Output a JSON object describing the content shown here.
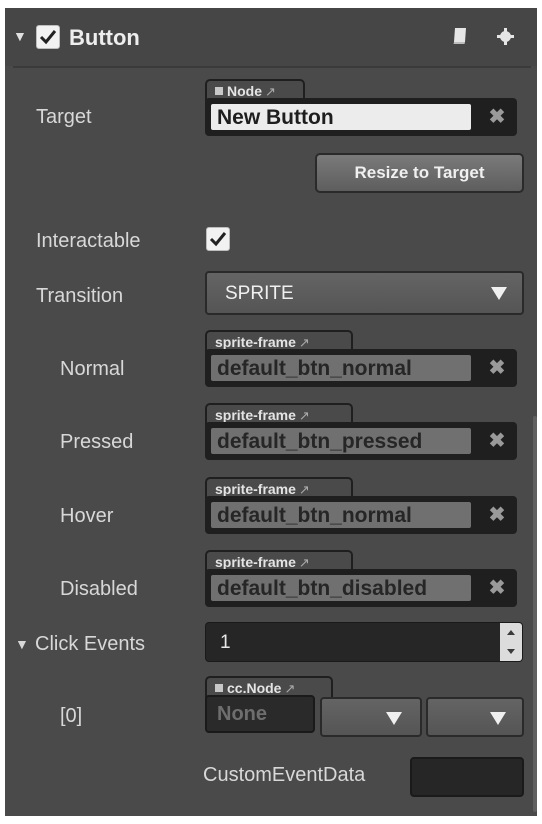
{
  "component": {
    "title": "Button",
    "enabled": true,
    "doc_icon": "book-icon",
    "settings_icon": "gear-icon",
    "collapse_icon": "triangle-down-icon"
  },
  "target": {
    "label": "Target",
    "tag": "Node",
    "value": "New Button",
    "clear_glyph": "✖",
    "resize_button": "Resize to Target"
  },
  "interactable": {
    "label": "Interactable",
    "checked": true
  },
  "transition": {
    "label": "Transition",
    "value": "SPRITE"
  },
  "sprites": [
    {
      "label": "Normal",
      "tag": "sprite-frame",
      "value": "default_btn_normal"
    },
    {
      "label": "Pressed",
      "tag": "sprite-frame",
      "value": "default_btn_pressed"
    },
    {
      "label": "Hover",
      "tag": "sprite-frame",
      "value": "default_btn_normal"
    },
    {
      "label": "Disabled",
      "tag": "sprite-frame",
      "value": "default_btn_disabled"
    }
  ],
  "click_events": {
    "label": "Click Events",
    "count": "1",
    "items": [
      {
        "index_label": "[0]",
        "tag": "cc.Node",
        "value": "None",
        "custom_label": "CustomEventData",
        "custom_value": ""
      }
    ]
  },
  "colors": {
    "panel_bg": "#4a4a4a",
    "field_bg": "#1f1f1f",
    "value_bg": "#707070",
    "target_value_bg": "#ececec"
  }
}
